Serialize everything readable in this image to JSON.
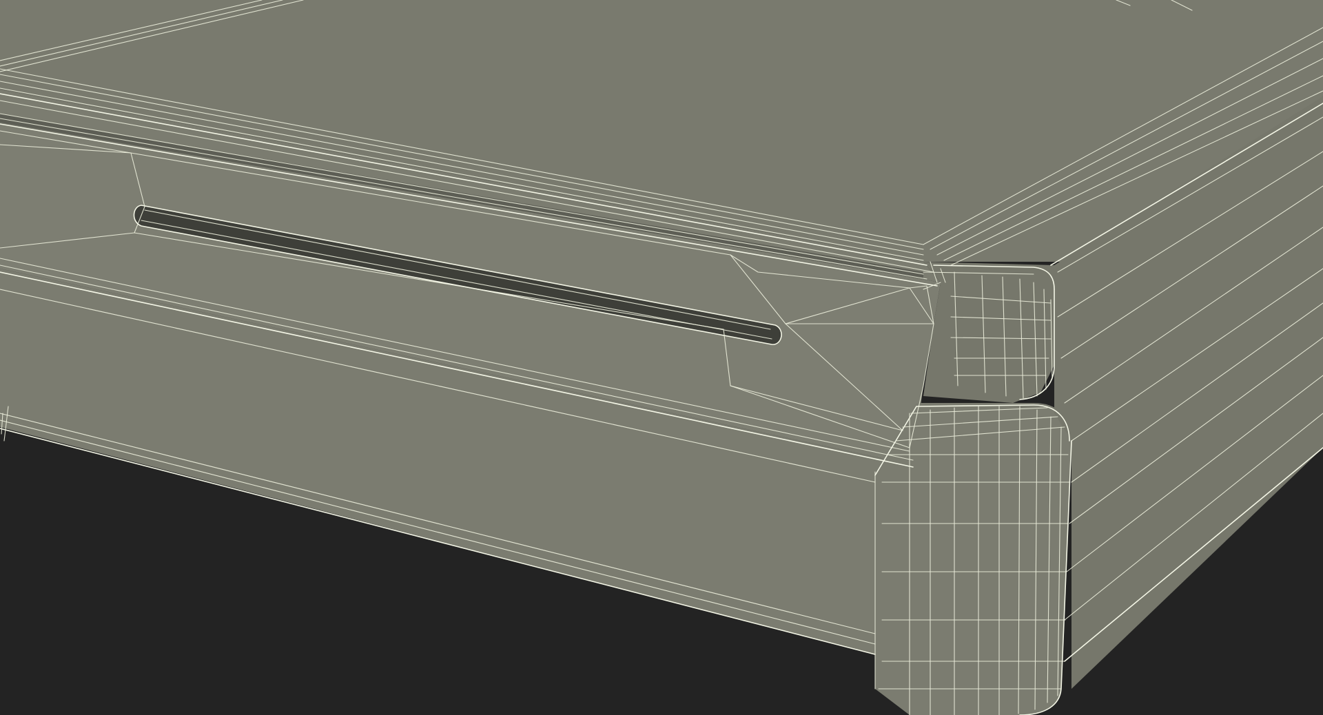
{
  "scene": {
    "subject": "",
    "render_style": "wireframe-over-shaded",
    "colors": {
      "background": "#232323",
      "surface": "#797a6e",
      "wire": "#e9ebd9",
      "slot": "#3e3f39"
    }
  }
}
